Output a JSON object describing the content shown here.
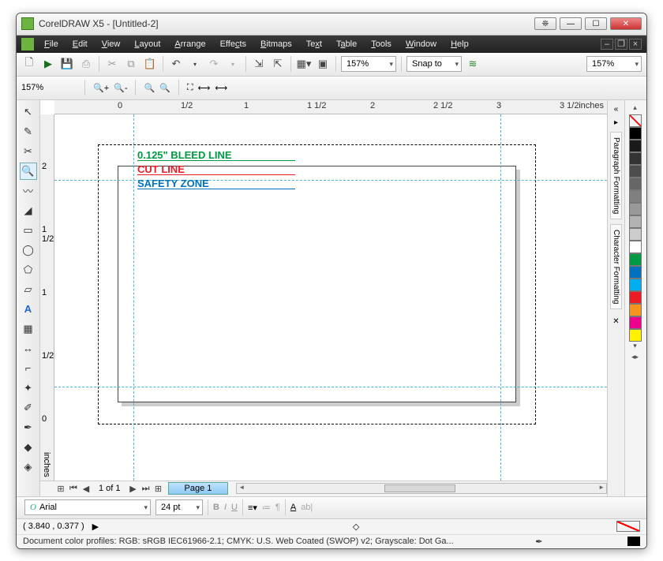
{
  "title": "CorelDRAW X5 - [Untitled-2]",
  "menu": [
    "File",
    "Edit",
    "View",
    "Layout",
    "Arrange",
    "Effects",
    "Bitmaps",
    "Text",
    "Table",
    "Tools",
    "Window",
    "Help"
  ],
  "toolbar": {
    "zoom1": "157%",
    "snap": "Snap to",
    "zoom2": "157%",
    "zoom3": "157%"
  },
  "ruler": {
    "h": [
      "0",
      "1/2",
      "1",
      "1 1/2",
      "2",
      "2 1/2",
      "3",
      "3 1/2"
    ],
    "v": [
      "2",
      "1 1/2",
      "1",
      "1/2",
      "0"
    ],
    "unit": "inches"
  },
  "labels": {
    "bleed": "0.125\" BLEED LINE",
    "cut": "CUT LINE",
    "safety": "SAFETY ZONE"
  },
  "pagenav": {
    "count": "1 of 1",
    "tab": "Page 1"
  },
  "propbar": {
    "font": "Arial",
    "size": "24 pt"
  },
  "status": {
    "coords": "( 3.840 , 0.377 )",
    "profiles": "Document color profiles: RGB: sRGB IEC61966-2.1; CMYK: U.S. Web Coated (SWOP) v2; Grayscale: Dot Ga..."
  },
  "docker": [
    "Paragraph Formatting",
    "Character Formatting"
  ],
  "palette": [
    "#000000",
    "#1a1a1a",
    "#333333",
    "#4d4d4d",
    "#666666",
    "#808080",
    "#999999",
    "#b3b3b3",
    "#cccccc",
    "#ffffff",
    "#009944",
    "#0071bc",
    "#ed1c24",
    "#ec008c",
    "#fff200"
  ],
  "colors": {
    "bleed": "#009944",
    "cut": "#ed1c24",
    "safety": "#0071bc",
    "guide": "#4fb3d9"
  }
}
